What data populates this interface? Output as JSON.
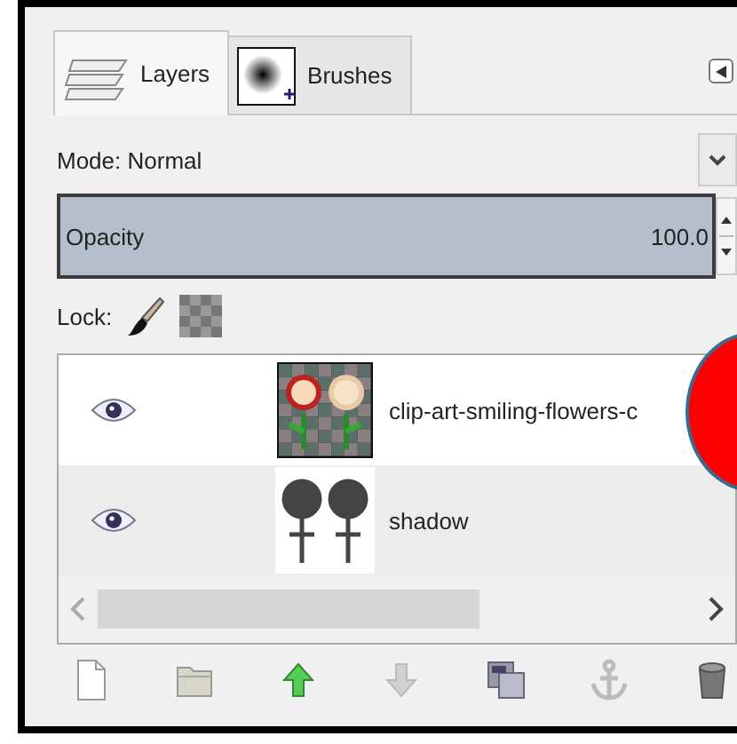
{
  "tabs": [
    {
      "label": "Layers",
      "kind": "layers",
      "selected": true
    },
    {
      "label": "Brushes",
      "kind": "brushes",
      "selected": false
    }
  ],
  "mode": {
    "label": "Mode: Normal"
  },
  "opacity": {
    "label": "Opacity",
    "value": "100.0",
    "level": 1
  },
  "lock": {
    "label": "Lock:"
  },
  "layers": [
    {
      "name": "clip-art-smiling-flowers-c",
      "kind": "color",
      "visible": true,
      "selected": true
    },
    {
      "name": "shadow",
      "kind": "shadow",
      "visible": true,
      "selected": false
    }
  ],
  "toolbar": [
    {
      "kind": "new",
      "disabled": false
    },
    {
      "kind": "folder",
      "disabled": false
    },
    {
      "kind": "raise",
      "disabled": false
    },
    {
      "kind": "lower",
      "disabled": true
    },
    {
      "kind": "duplicate",
      "disabled": false
    },
    {
      "kind": "anchor",
      "disabled": true
    },
    {
      "kind": "delete",
      "disabled": false
    }
  ]
}
